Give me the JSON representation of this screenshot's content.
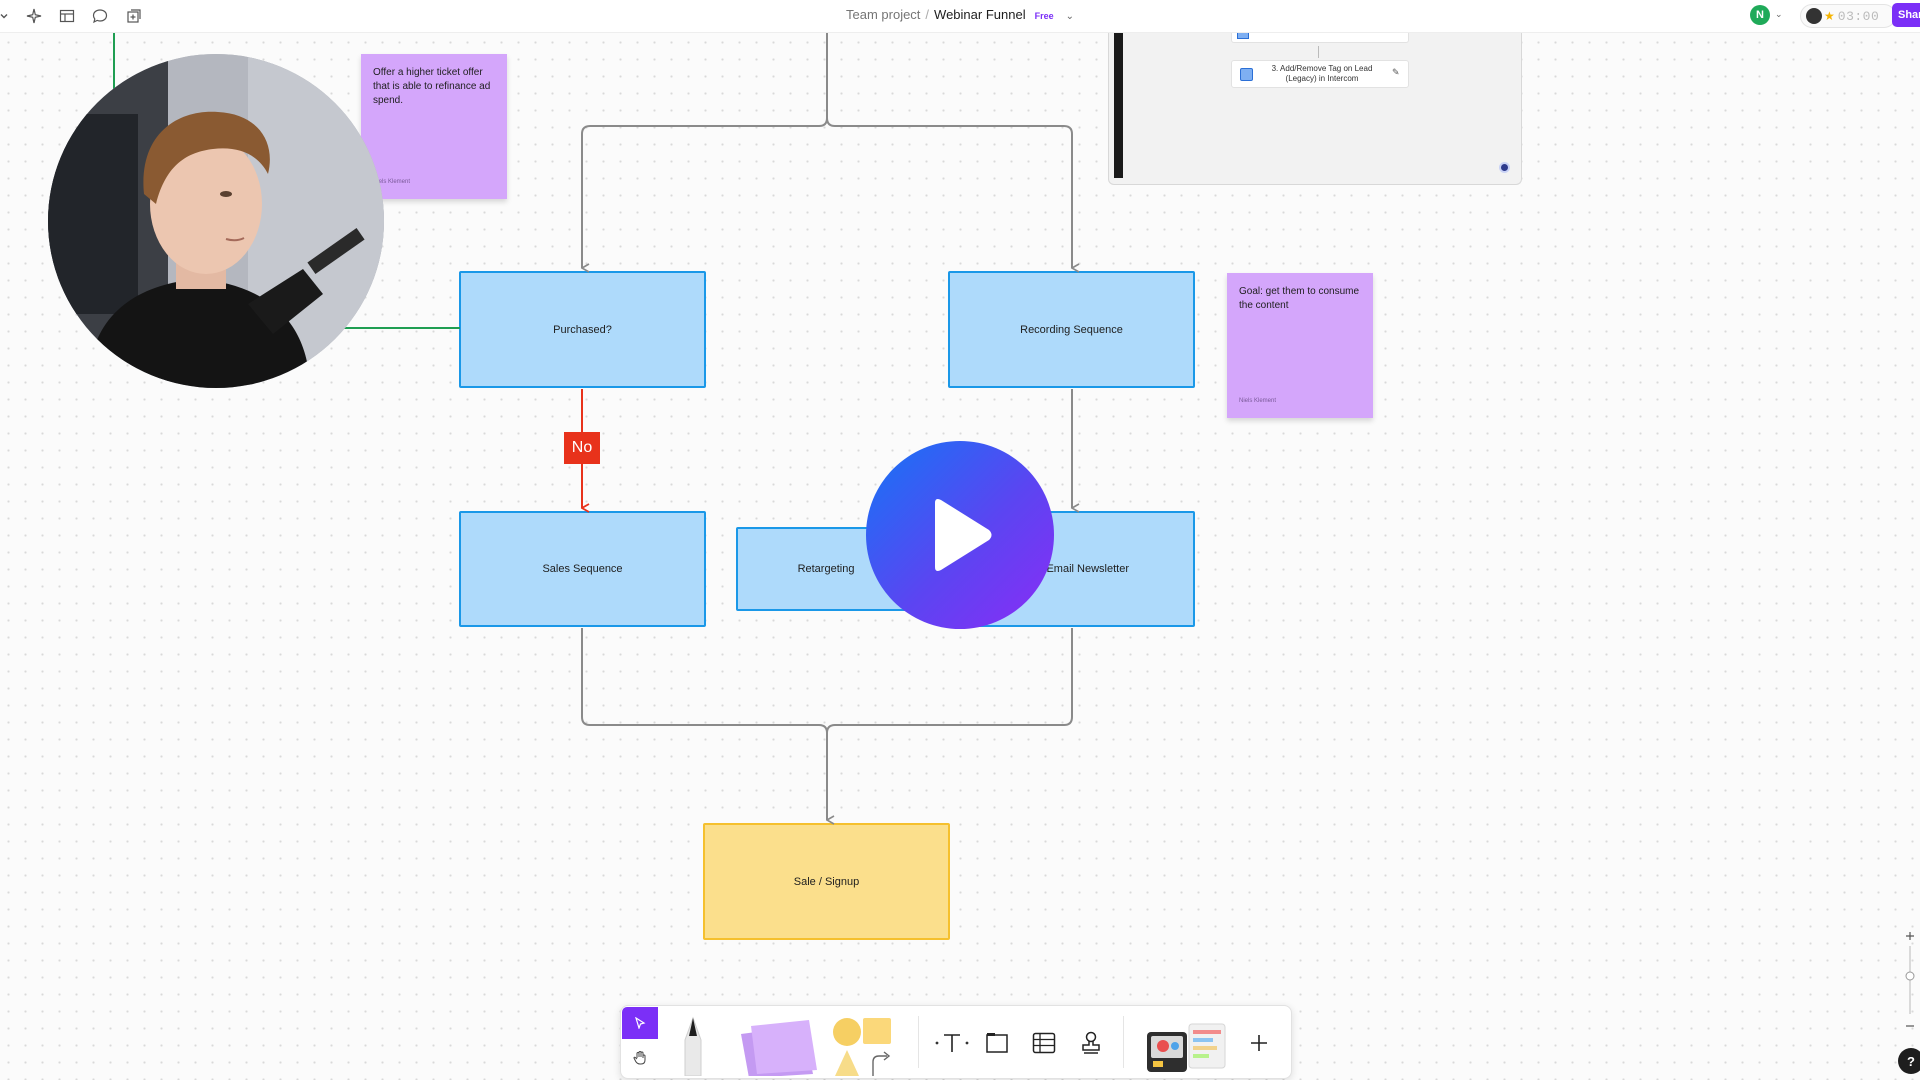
{
  "topbar": {
    "breadcrumb_parent": "Team project",
    "separator": "/",
    "file_name": "Webinar Funnel",
    "plan_badge": "Free",
    "avatar_initial": "N",
    "timer": "03:00",
    "share_label": "Share",
    "icons": [
      "chevron-down-icon",
      "sparkle-icon",
      "layout-icon",
      "comment-icon",
      "add-page-icon"
    ]
  },
  "nodes": {
    "purchased": "Purchased?",
    "recording_sequence": "Recording Sequence",
    "sales_sequence": "Sales Sequence",
    "retargeting": "Retargeting",
    "email_newsletter": "Email Newsletter",
    "sale_signup": "Sale / Signup"
  },
  "edge_labels": {
    "no": "No"
  },
  "stickies": [
    {
      "text": "Offer a higher ticket offer that is able to refinance ad spend.",
      "author": "Niels Klement"
    },
    {
      "text": "Goal: get them to consume the content",
      "author": "Niels Klement"
    }
  ],
  "embed": {
    "step_text": "3. Add/Remove Tag on Lead (Legacy) in Intercom"
  },
  "toolbar": {
    "tools": [
      "select-tool",
      "hand-tool",
      "marker-tool",
      "sticky-note-tool",
      "shapes-tool",
      "text-tool",
      "section-tool",
      "table-tool",
      "stamp-tool",
      "widgets-tool",
      "more-tool"
    ]
  },
  "help_label": "?",
  "colors": {
    "node_fill": "#aedafb",
    "node_border": "#1a98e8",
    "sale_fill": "#fbdf8c",
    "sticky": "#d4a6fb",
    "no_badge": "#e8321b",
    "accent": "#7b2ff7"
  }
}
